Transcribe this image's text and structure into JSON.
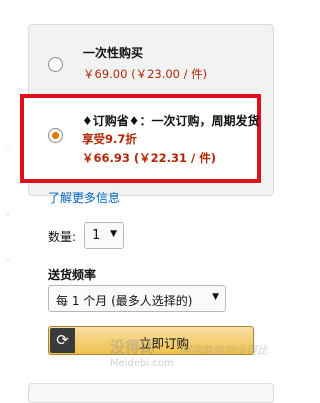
{
  "option_onetime": {
    "title": "一次性购买",
    "price": "￥69.00 (￥23.00 / 件)",
    "selected": false
  },
  "option_subscribe": {
    "title": "♦订购省♦：一次订购，周期发货",
    "discount": "享受9.7折",
    "price": "￥66.93 (￥22.31 / 件)",
    "selected": true
  },
  "learn_more": "了解更多信息",
  "quantity": {
    "label": "数量:",
    "value": "1"
  },
  "frequency": {
    "label": "送货频率",
    "value": "每 1 个月 (最多人选择的)"
  },
  "subscribe_button": {
    "label": "立即订购",
    "icon": "refresh-icon"
  },
  "watermark": {
    "brand": "没得比",
    "slogan": "网购能做到没得比",
    "domain": "Meidebi.com"
  },
  "colors": {
    "price": "#b12704",
    "highlight_border": "#e1101d",
    "link": "#0066c0",
    "button": "#f0c14b",
    "radio_selected": "#e77600"
  }
}
